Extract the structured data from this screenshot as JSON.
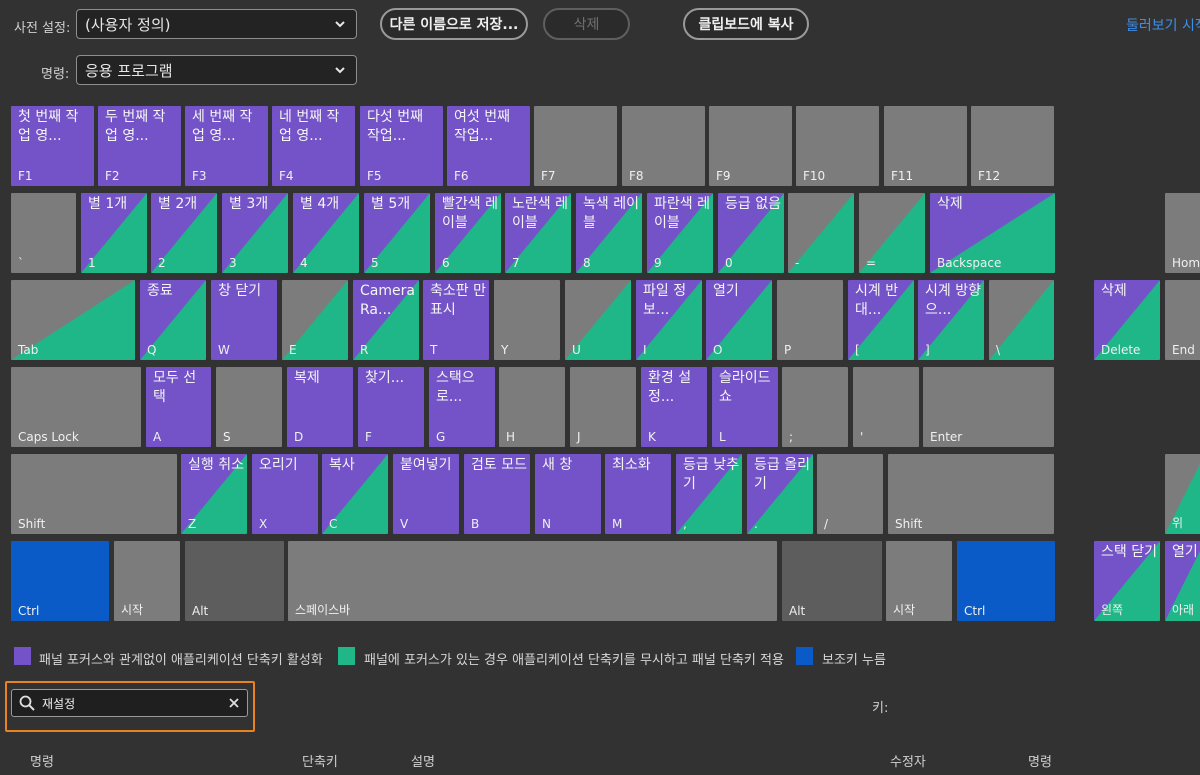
{
  "toolbar": {
    "preset_label": "사전 설정:",
    "preset_value": "(사용자 정의)",
    "command_label": "명령:",
    "command_value": "응용 프로그램",
    "save_as_label": "다른 이름으로 저장...",
    "delete_label": "삭제",
    "copy_clipboard_label": "클립보드에 복사",
    "browse_link": "둘러보기 시작"
  },
  "keyboard": {
    "rows": [
      [
        {
          "cap": "F1",
          "cmd": "첫 번째 작업 영...",
          "color": "purple"
        },
        {
          "cap": "F2",
          "cmd": "두 번째 작업 영...",
          "color": "purple"
        },
        {
          "cap": "F3",
          "cmd": "세 번째 작업 영...",
          "color": "purple"
        },
        {
          "cap": "F4",
          "cmd": "네 번째 작업 영...",
          "color": "purple"
        },
        {
          "cap": "F5",
          "cmd": "다섯 번째 작업...",
          "color": "purple"
        },
        {
          "cap": "F6",
          "cmd": "여섯 번째 작업...",
          "color": "purple"
        },
        {
          "cap": "F7",
          "cmd": "",
          "color": "gray"
        },
        {
          "cap": "F8",
          "cmd": "",
          "color": "gray"
        },
        {
          "cap": "F9",
          "cmd": "",
          "color": "gray"
        },
        {
          "cap": "F10",
          "cmd": "",
          "color": "gray"
        },
        {
          "cap": "F11",
          "cmd": "",
          "color": "gray"
        },
        {
          "cap": "F12",
          "cmd": "",
          "color": "gray"
        }
      ],
      [
        {
          "cap": "`",
          "cmd": "",
          "color": "gray"
        },
        {
          "cap": "1",
          "cmd": "별 1개",
          "color": "split"
        },
        {
          "cap": "2",
          "cmd": "별 2개",
          "color": "split"
        },
        {
          "cap": "3",
          "cmd": "별 3개",
          "color": "split"
        },
        {
          "cap": "4",
          "cmd": "별 4개",
          "color": "split"
        },
        {
          "cap": "5",
          "cmd": "별 5개",
          "color": "split"
        },
        {
          "cap": "6",
          "cmd": "빨간색 레이블",
          "color": "split"
        },
        {
          "cap": "7",
          "cmd": "노란색 레이블",
          "color": "split"
        },
        {
          "cap": "8",
          "cmd": "녹색 레이블",
          "color": "split"
        },
        {
          "cap": "9",
          "cmd": "파란색 레이블",
          "color": "split"
        },
        {
          "cap": "0",
          "cmd": "등급 없음",
          "color": "split"
        },
        {
          "cap": "-",
          "cmd": "",
          "color": "splitgray"
        },
        {
          "cap": "=",
          "cmd": "",
          "color": "splitgray"
        },
        {
          "cap": "Backspace",
          "cmd": "삭제",
          "color": "split"
        },
        {
          "cap": "Home",
          "cmd": "",
          "color": "gray"
        }
      ],
      [
        {
          "cap": "Tab",
          "cmd": "",
          "color": "splitgray"
        },
        {
          "cap": "Q",
          "cmd": "종료",
          "color": "split"
        },
        {
          "cap": "W",
          "cmd": "창 닫기",
          "color": "purple"
        },
        {
          "cap": "E",
          "cmd": "",
          "color": "splitgray"
        },
        {
          "cap": "R",
          "cmd": "Camera Ra...",
          "color": "split"
        },
        {
          "cap": "T",
          "cmd": "축소판 만 표시",
          "color": "purple"
        },
        {
          "cap": "Y",
          "cmd": "",
          "color": "gray"
        },
        {
          "cap": "U",
          "cmd": "",
          "color": "splitgray"
        },
        {
          "cap": "I",
          "cmd": "파일 정보...",
          "color": "split"
        },
        {
          "cap": "O",
          "cmd": "열기",
          "color": "split"
        },
        {
          "cap": "P",
          "cmd": "",
          "color": "gray"
        },
        {
          "cap": "[",
          "cmd": "시계 반대...",
          "color": "split"
        },
        {
          "cap": "]",
          "cmd": "시계 방향으...",
          "color": "split"
        },
        {
          "cap": "\\",
          "cmd": "",
          "color": "splitgray"
        },
        {
          "cap": "Delete",
          "cmd": "삭제",
          "color": "split"
        },
        {
          "cap": "End",
          "cmd": "",
          "color": "gray"
        }
      ],
      [
        {
          "cap": "Caps Lock",
          "cmd": "",
          "color": "gray"
        },
        {
          "cap": "A",
          "cmd": "모두 선택",
          "color": "purple"
        },
        {
          "cap": "S",
          "cmd": "",
          "color": "gray"
        },
        {
          "cap": "D",
          "cmd": "복제",
          "color": "purple"
        },
        {
          "cap": "F",
          "cmd": "찾기...",
          "color": "purple"
        },
        {
          "cap": "G",
          "cmd": "스택으로...",
          "color": "purple"
        },
        {
          "cap": "H",
          "cmd": "",
          "color": "gray"
        },
        {
          "cap": "J",
          "cmd": "",
          "color": "gray"
        },
        {
          "cap": "K",
          "cmd": "환경 설정...",
          "color": "purple"
        },
        {
          "cap": "L",
          "cmd": "슬라이드 쇼",
          "color": "purple"
        },
        {
          "cap": ";",
          "cmd": "",
          "color": "gray"
        },
        {
          "cap": "'",
          "cmd": "",
          "color": "gray"
        },
        {
          "cap": "Enter",
          "cmd": "",
          "color": "gray"
        }
      ],
      [
        {
          "cap": "Shift",
          "cmd": "",
          "color": "gray"
        },
        {
          "cap": "Z",
          "cmd": "실행 취소",
          "color": "split"
        },
        {
          "cap": "X",
          "cmd": "오리기",
          "color": "purple"
        },
        {
          "cap": "C",
          "cmd": "복사",
          "color": "split"
        },
        {
          "cap": "V",
          "cmd": "붙여넣기",
          "color": "purple"
        },
        {
          "cap": "B",
          "cmd": "검토 모드",
          "color": "purple"
        },
        {
          "cap": "N",
          "cmd": "새 창",
          "color": "purple"
        },
        {
          "cap": "M",
          "cmd": "최소화",
          "color": "purple"
        },
        {
          "cap": ",",
          "cmd": "등급 낮추기",
          "color": "split"
        },
        {
          "cap": ".",
          "cmd": "등급 올리기",
          "color": "split"
        },
        {
          "cap": "/",
          "cmd": "",
          "color": "gray"
        },
        {
          "cap": "Shift",
          "cmd": "",
          "color": "gray"
        },
        {
          "cap": "위",
          "cmd": "",
          "color": "splitgray"
        }
      ],
      [
        {
          "cap": "Ctrl",
          "cmd": "",
          "color": "blue"
        },
        {
          "cap": "시작",
          "cmd": "",
          "color": "gray"
        },
        {
          "cap": "Alt",
          "cmd": "",
          "color": "dark"
        },
        {
          "cap": "스페이스바",
          "cmd": "",
          "color": "gray"
        },
        {
          "cap": "Alt",
          "cmd": "",
          "color": "dark"
        },
        {
          "cap": "시작",
          "cmd": "",
          "color": "gray"
        },
        {
          "cap": "Ctrl",
          "cmd": "",
          "color": "blue"
        },
        {
          "cap": "왼쪽",
          "cmd": "스택 닫기",
          "color": "split"
        },
        {
          "cap": "아래",
          "cmd": "열기",
          "color": "split"
        }
      ]
    ]
  },
  "legend": {
    "app_label": "패널 포커스와 관계없이 애플리케이션 단축키 활성화",
    "panel_label": "패널에 포커스가 있는 경우 애플리케이션 단축키를 무시하고 패널 단축키 적용",
    "modifier_label": "보조키 누름",
    "colors": {
      "purple": "#7453c8",
      "green": "#1fb787",
      "blue": "#0a5bc7",
      "gray": "#7c7c7c"
    }
  },
  "search": {
    "value": "재설정"
  },
  "key_label": "키:",
  "columns": [
    "명령",
    "단축키",
    "설명",
    "수정자",
    "명령"
  ]
}
